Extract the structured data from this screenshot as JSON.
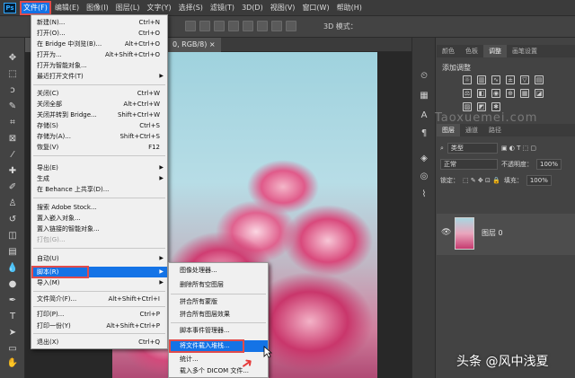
{
  "app": {
    "logo": "Ps"
  },
  "menubar": {
    "items": [
      "文件(F)",
      "编辑(E)",
      "图像(I)",
      "图层(L)",
      "文字(Y)",
      "选择(S)",
      "滤镜(T)",
      "3D(D)",
      "视图(V)",
      "窗口(W)",
      "帮助(H)"
    ]
  },
  "document": {
    "tab_label": "0, RGB/8) ×"
  },
  "optionsbar": {
    "mode": "3D 模式："
  },
  "file_menu": {
    "items": [
      {
        "label": "新建(N)...",
        "shortcut": "Ctrl+N"
      },
      {
        "label": "打开(O)...",
        "shortcut": "Ctrl+O"
      },
      {
        "label": "在 Bridge 中浏览(B)...",
        "shortcut": "Alt+Ctrl+O"
      },
      {
        "label": "打开为...",
        "shortcut": "Alt+Shift+Ctrl+O"
      },
      {
        "label": "打开为智能对象...",
        "shortcut": ""
      },
      {
        "label": "最近打开文件(T)",
        "shortcut": ""
      },
      {
        "label": "关闭(C)",
        "shortcut": "Ctrl+W"
      },
      {
        "label": "关闭全部",
        "shortcut": "Alt+Ctrl+W"
      },
      {
        "label": "关闭并转到 Bridge...",
        "shortcut": "Shift+Ctrl+W"
      },
      {
        "label": "存储(S)",
        "shortcut": "Ctrl+S"
      },
      {
        "label": "存储为(A)...",
        "shortcut": "Shift+Ctrl+S"
      },
      {
        "label": "恢复(V)",
        "shortcut": "F12"
      },
      {
        "label": "导出(E)",
        "shortcut": ""
      },
      {
        "label": "生成",
        "shortcut": ""
      },
      {
        "label": "在 Behance 上共享(D)...",
        "shortcut": ""
      },
      {
        "label": "搜索 Adobe Stock...",
        "shortcut": ""
      },
      {
        "label": "置入嵌入对象...",
        "shortcut": ""
      },
      {
        "label": "置入链接的智能对象...",
        "shortcut": ""
      },
      {
        "label": "打包(G)...",
        "shortcut": ""
      },
      {
        "label": "自动(U)",
        "shortcut": ""
      },
      {
        "label": "脚本(R)",
        "shortcut": ""
      },
      {
        "label": "导入(M)",
        "shortcut": ""
      },
      {
        "label": "文件简介(F)...",
        "shortcut": "Alt+Shift+Ctrl+I"
      },
      {
        "label": "打印(P)...",
        "shortcut": "Ctrl+P"
      },
      {
        "label": "打印一份(Y)",
        "shortcut": "Alt+Shift+Ctrl+P"
      },
      {
        "label": "退出(X)",
        "shortcut": "Ctrl+Q"
      }
    ]
  },
  "scripts_menu": {
    "items": [
      "图像处理器...",
      "删除所有空图层",
      "拼合所有蒙版",
      "拼合所有图层效果",
      "脚本事件管理器...",
      "将文件载入堆栈...",
      "统计...",
      "载入多个 DICOM 文件..."
    ]
  },
  "panels": {
    "top_tabs": [
      "颜色",
      "色板",
      "调整",
      "画笔设置"
    ],
    "adjust_title": "添加调整",
    "layer_tabs": [
      "图层",
      "通道",
      "路径"
    ],
    "kind_label": "类型",
    "blend_mode": "正常",
    "opacity_label": "不透明度：",
    "opacity_value": "100%",
    "lock_label": "锁定：",
    "fill_label": "填充：",
    "fill_value": "100%",
    "layer_name": "图层 0"
  },
  "watermarks": {
    "site": "Taoxuemei.com",
    "author": "头条 @风中浅夏"
  },
  "colors": {
    "accent": "#1473e6",
    "highlight_box": "#e14b4b"
  }
}
